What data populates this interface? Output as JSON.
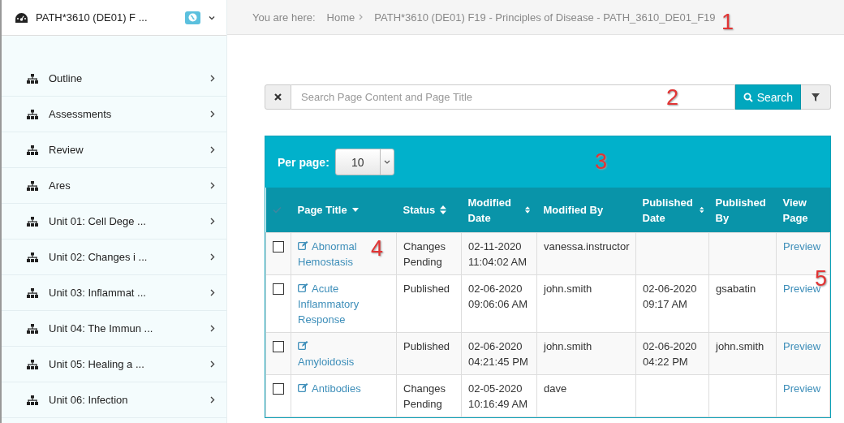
{
  "course_selector": {
    "title": "PATH*3610 (DE01) F ..."
  },
  "breadcrumb": {
    "label": "You are here:",
    "items": [
      {
        "text": "Home"
      },
      {
        "text": "PATH*3610 (DE01) F19 - Principles of Disease - PATH_3610_DE01_F19"
      }
    ]
  },
  "sidebar": {
    "items": [
      {
        "label": "Outline"
      },
      {
        "label": "Assessments"
      },
      {
        "label": "Review"
      },
      {
        "label": "Ares"
      },
      {
        "label": "Unit 01: Cell Dege ..."
      },
      {
        "label": "Unit 02: Changes i ..."
      },
      {
        "label": "Unit 03: Inflammat ..."
      },
      {
        "label": "Unit 04: The Immun ..."
      },
      {
        "label": "Unit 05: Healing a ..."
      },
      {
        "label": "Unit 06: Infection"
      }
    ]
  },
  "search": {
    "placeholder": "Search Page Content and Page Title",
    "button": "Search"
  },
  "table": {
    "per_page_label": "Per page:",
    "per_page": "10",
    "columns": [
      {
        "label": "Page Title",
        "sortable": true,
        "sorted": true
      },
      {
        "label": "Status",
        "sortable": true,
        "sorted": false
      },
      {
        "label": "Modified Date",
        "sortable": true,
        "sorted": false
      },
      {
        "label": "Modified By",
        "sortable": false,
        "sorted": false
      },
      {
        "label": "Published Date",
        "sortable": true,
        "sorted": false
      },
      {
        "label": "Published By",
        "sortable": false,
        "sorted": false
      },
      {
        "label": "View Page",
        "sortable": false,
        "sorted": false
      }
    ],
    "rows": [
      {
        "checked": false,
        "title": "Abnormal Hemostasis",
        "status": "Changes Pending",
        "modified_date": "02-11-2020 11:04:02 AM",
        "modified_by": "vanessa.instructor",
        "published_date": "",
        "published_by": "",
        "view": "Preview"
      },
      {
        "checked": false,
        "title": "Acute Inflammatory Response",
        "status": "Published",
        "modified_date": "02-06-2020 09:06:06 AM",
        "modified_by": "john.smith",
        "published_date": "02-06-2020 09:17 AM",
        "published_by": "gsabatin",
        "view": "Preview"
      },
      {
        "checked": false,
        "title": "Amyloidosis",
        "status": "Published",
        "modified_date": "02-06-2020 04:21:45 PM",
        "modified_by": "john.smith",
        "published_date": "02-06-2020 04:22 PM",
        "published_by": "john.smith",
        "view": "Preview"
      },
      {
        "checked": false,
        "title": "Antibodies",
        "status": "Changes Pending",
        "modified_date": "02-05-2020 10:16:49 AM",
        "modified_by": "dave",
        "published_date": "",
        "published_by": "",
        "view": "Preview"
      }
    ]
  },
  "annotations": [
    {
      "text": "1"
    },
    {
      "text": "2"
    },
    {
      "text": "3"
    },
    {
      "text": "4"
    },
    {
      "text": "5"
    }
  ]
}
